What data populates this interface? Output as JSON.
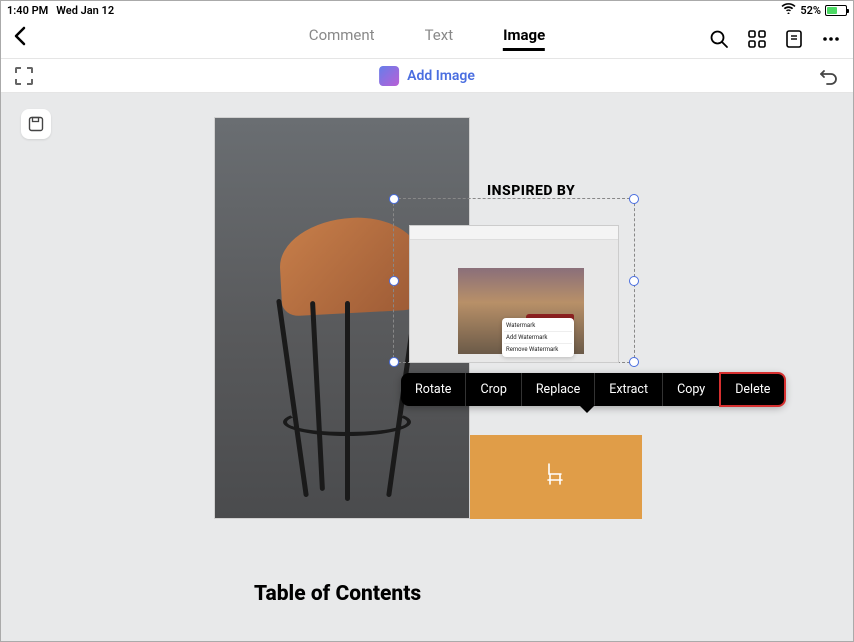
{
  "status_bar": {
    "time": "1:40 PM",
    "date": "Wed Jan 12",
    "battery_percent": "52%"
  },
  "top_toolbar": {
    "tabs": [
      {
        "label": "Comment"
      },
      {
        "label": "Text"
      },
      {
        "label": "Image"
      }
    ]
  },
  "secondary_toolbar": {
    "add_image_label": "Add Image"
  },
  "document": {
    "inspired_label": "INSPIRED BY",
    "toc_label": "Table of Contents"
  },
  "inserted_popup": {
    "title": "Watermark",
    "add_label": "Add Watermark",
    "remove_label": "Remove Watermark"
  },
  "context_menu": {
    "items": [
      {
        "label": "Rotate"
      },
      {
        "label": "Crop"
      },
      {
        "label": "Replace"
      },
      {
        "label": "Extract"
      },
      {
        "label": "Copy"
      },
      {
        "label": "Delete"
      }
    ]
  }
}
